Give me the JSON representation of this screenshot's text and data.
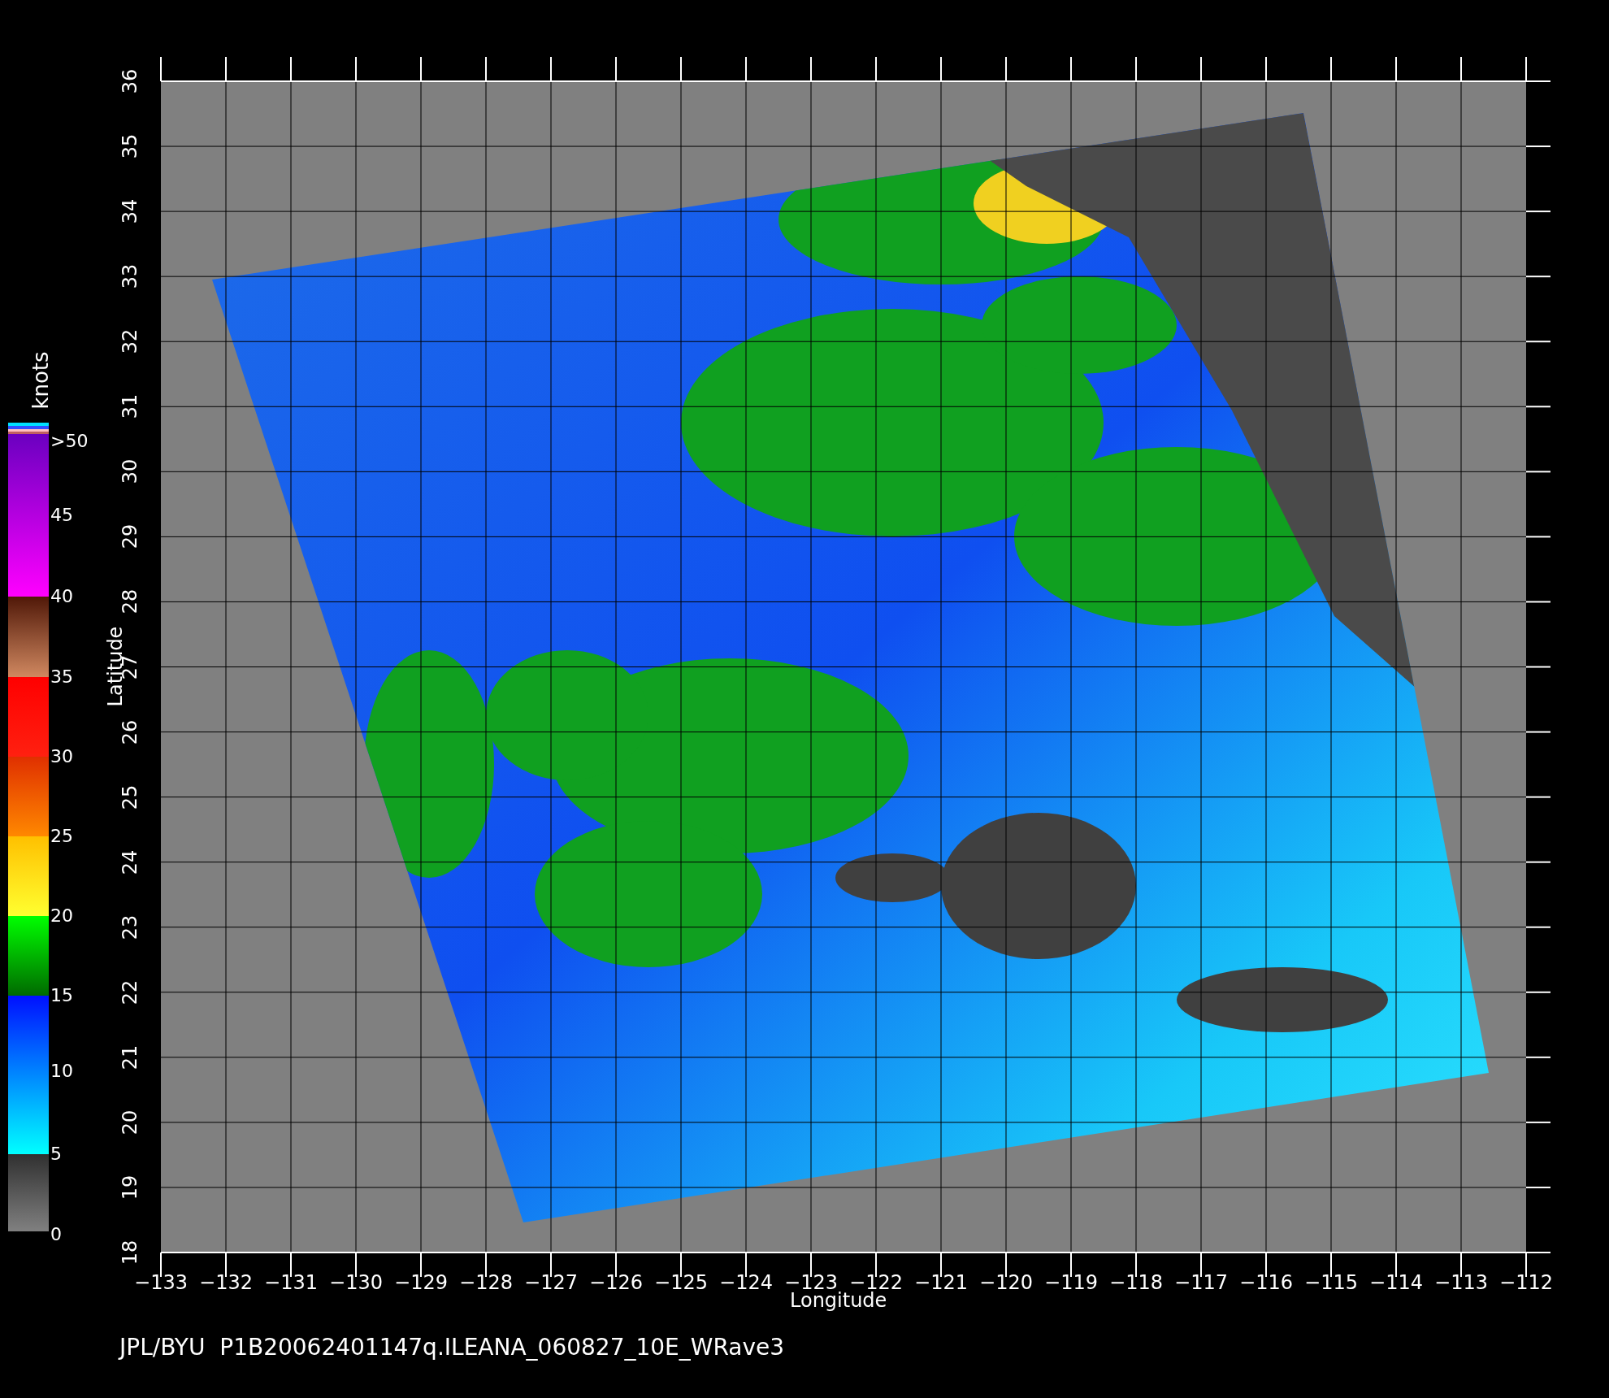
{
  "colorbar": {
    "unit": "knots",
    "labels": [
      ">50",
      "45",
      "40",
      "35",
      "30",
      "25",
      "20",
      "15",
      "10",
      "5",
      "0"
    ]
  },
  "y_axis": {
    "label": "Latitude",
    "ticks": [
      "36",
      "35",
      "34",
      "33",
      "32",
      "31",
      "30",
      "29",
      "28",
      "27",
      "26",
      "25",
      "24",
      "23",
      "22",
      "21",
      "20",
      "19",
      "18"
    ]
  },
  "x_axis": {
    "label": "Longitude",
    "ticks": [
      "−133",
      "−132",
      "−131",
      "−130",
      "−129",
      "−128",
      "−127",
      "−126",
      "−125",
      "−124",
      "−123",
      "−122",
      "−121",
      "−120",
      "−119",
      "−118",
      "−117",
      "−116",
      "−115",
      "−114",
      "−113",
      "−112"
    ]
  },
  "caption": "JPL/BYU  P1B20062401147q.ILEANA_060827_10E_WRave3"
}
